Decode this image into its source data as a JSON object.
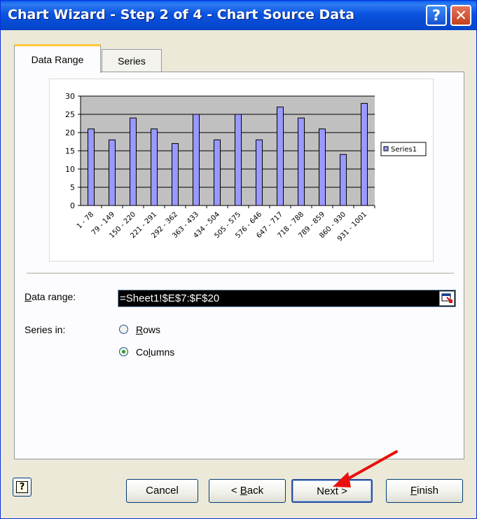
{
  "window": {
    "title": "Chart Wizard - Step 2 of 4 - Chart Source Data",
    "help_glyph": "?",
    "close_glyph": "✕"
  },
  "tabs": [
    {
      "label": "Data Range",
      "active": true
    },
    {
      "label": "Series",
      "active": false
    }
  ],
  "chart_data": {
    "type": "bar",
    "categories": [
      "1 - 78",
      "79 - 149",
      "150 - 220",
      "221 - 291",
      "292 - 362",
      "363 - 433",
      "434 - 504",
      "505 - 575",
      "576 - 646",
      "647 - 717",
      "718 - 788",
      "789 - 859",
      "860 - 930",
      "931 - 1001"
    ],
    "series": [
      {
        "name": "Series1",
        "values": [
          21,
          18,
          24,
          21,
          17,
          25,
          18,
          25,
          18,
          27,
          24,
          21,
          14,
          28
        ]
      }
    ],
    "ylim": [
      0,
      30
    ],
    "yticks": [
      0,
      5,
      10,
      15,
      20,
      25,
      30
    ],
    "grid": true,
    "legend": "right",
    "colors": {
      "plot_bg": "#C0C0C0",
      "bar": "#9999FF"
    }
  },
  "data_range": {
    "label_prefix": "D",
    "label_rest": "ata range:",
    "value": "=Sheet1!$E$7:$F$20"
  },
  "series_in": {
    "label": "Series in:",
    "options": [
      {
        "accel": "R",
        "rest": "ows",
        "selected": false
      },
      {
        "pre": "Co",
        "accel": "l",
        "rest": "umns",
        "selected": true
      }
    ]
  },
  "buttons": {
    "cancel": "Cancel",
    "back": {
      "pre": "< ",
      "accel": "B",
      "rest": "ack"
    },
    "next": "Next >",
    "finish": {
      "accel": "F",
      "rest": "inish"
    }
  },
  "colors": {
    "annotation_arrow": "#E8100C",
    "title_bar": "#0A53E0"
  }
}
